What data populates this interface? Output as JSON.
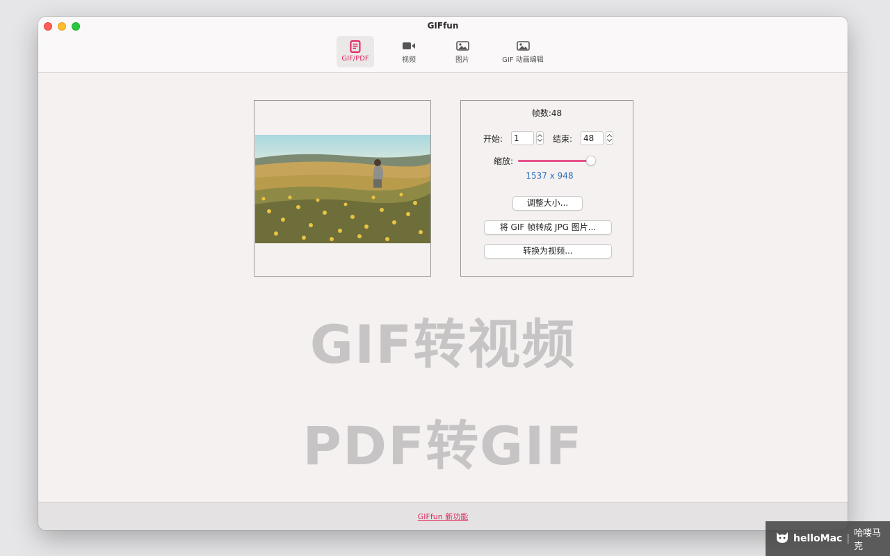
{
  "window": {
    "title": "GIFfun"
  },
  "tabs": [
    {
      "label": "GIF/PDF",
      "icon": "document-icon",
      "active": true
    },
    {
      "label": "视频",
      "icon": "video-camera-icon",
      "active": false
    },
    {
      "label": "图片",
      "icon": "image-icon",
      "active": false
    },
    {
      "label": "GIF 动画编辑",
      "icon": "image-icon",
      "active": false
    }
  ],
  "panel": {
    "frames_text": "帧数:48",
    "start_label": "开始:",
    "start_value": "1",
    "end_label": "结束:",
    "end_value": "48",
    "scale_label": "缩放:",
    "scale_level": 0.95,
    "dimensions": "1537 x 948",
    "buttons": {
      "resize": "调整大小...",
      "to_jpg": "将 GIF 帧转成 JPG 图片...",
      "to_video": "转换为视频..."
    }
  },
  "watermark": {
    "line1": "GIF转视频",
    "line2": "PDF转GIF"
  },
  "footer": {
    "link": "GIFfun 新功能"
  },
  "brand": {
    "name": "helloMac",
    "separator": "|",
    "cn": "哈喽马克"
  },
  "colors": {
    "accent": "#e0245c",
    "slider": "#e8508a",
    "dims": "#2f6fb8"
  }
}
